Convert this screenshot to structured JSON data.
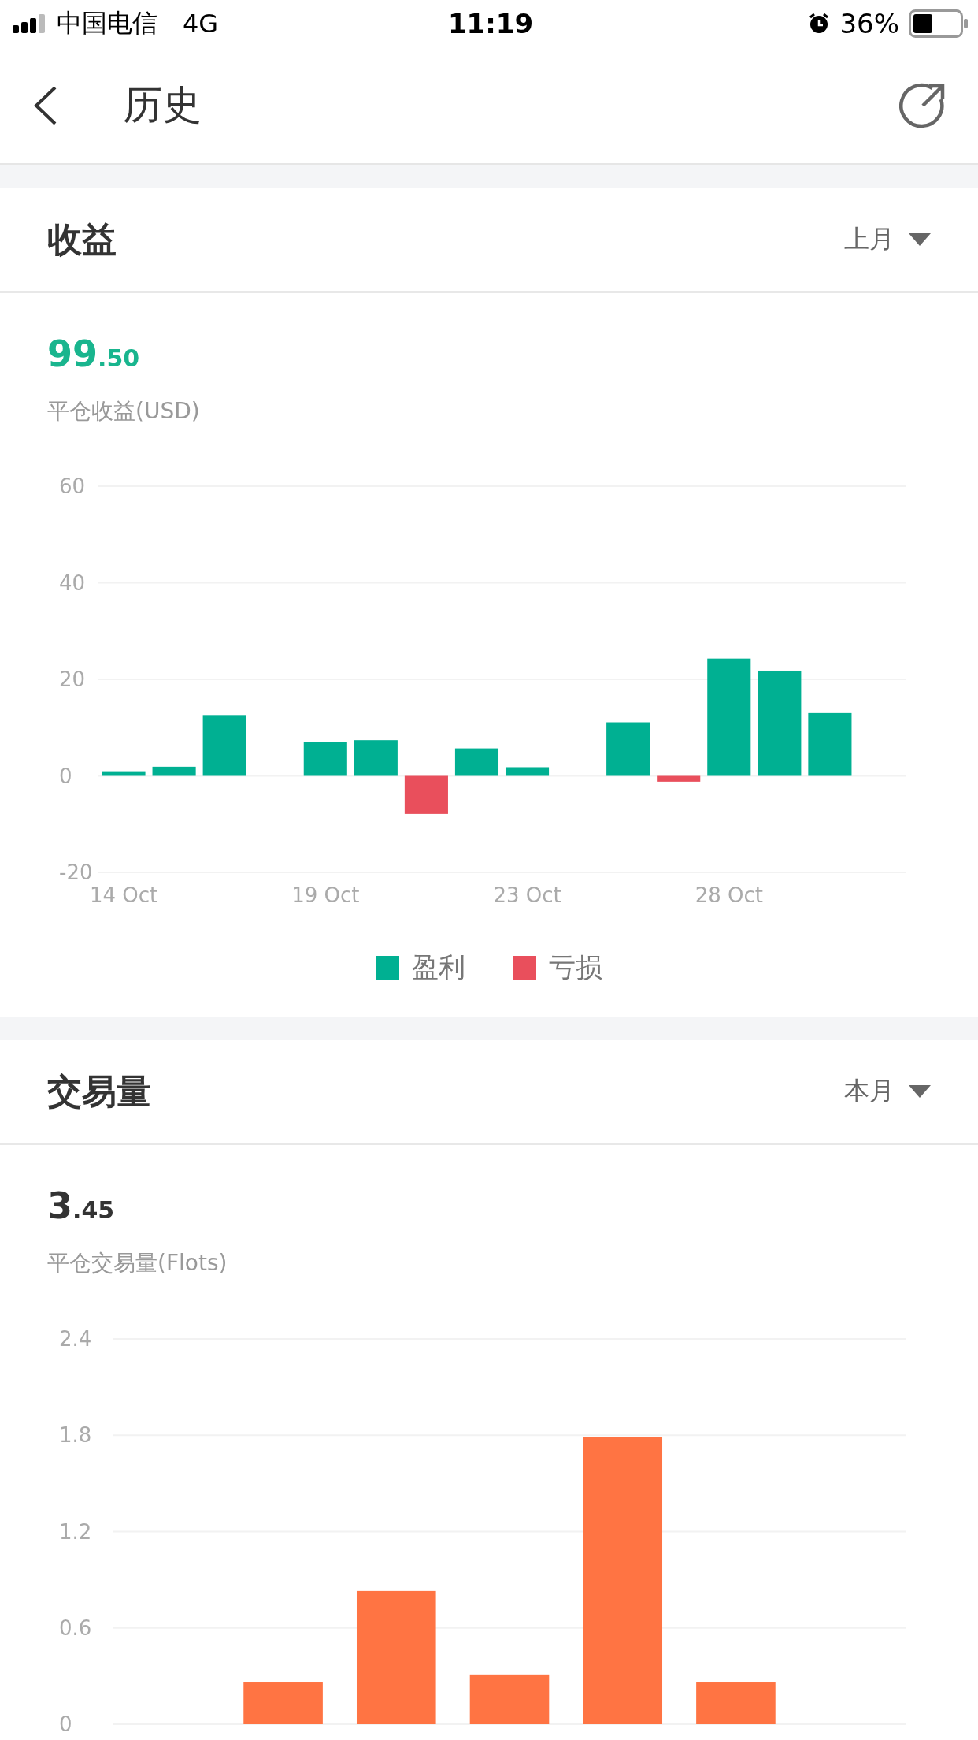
{
  "status_bar": {
    "carrier": "中国电信",
    "network": "4G",
    "time": "11:19",
    "battery": "36%"
  },
  "nav": {
    "title": "历史"
  },
  "sections": [
    {
      "kind": "profit",
      "title": "收益",
      "period": "上月",
      "value": "99.50",
      "value_label": "平仓收益(USD)",
      "chart_data": {
        "type": "bar",
        "categories": [
          "14 Oct",
          null,
          null,
          null,
          "19 Oct",
          null,
          null,
          null,
          "23 Oct",
          null,
          null,
          null,
          "28 Oct",
          null,
          null,
          null
        ],
        "ylim": [
          -20,
          60
        ],
        "yticks": [
          -20,
          0,
          20,
          40,
          60
        ],
        "grid": true,
        "legend": "bottom",
        "stacked": true,
        "series": [
          {
            "name": "盈利",
            "color": "#00b092",
            "values": [
              0.8,
              1.9,
              12.6,
              null,
              7.1,
              7.4,
              null,
              5.7,
              1.8,
              null,
              11.1,
              null,
              24.3,
              21.8,
              13.0,
              null
            ]
          },
          {
            "name": "亏损",
            "color": "#e94f5c",
            "values": [
              null,
              null,
              null,
              null,
              null,
              null,
              -7.9,
              null,
              null,
              null,
              null,
              -1.2,
              null,
              null,
              null,
              null
            ]
          }
        ]
      }
    },
    {
      "kind": "volume",
      "title": "交易量",
      "period": "本月",
      "value": "3.45",
      "value_label": "平仓交易量(Flots)",
      "chart_data": {
        "type": "bar",
        "categories": [
          null,
          null,
          null,
          null,
          null,
          null,
          null
        ],
        "ylim": [
          0,
          2.4
        ],
        "yticks": [
          0,
          0.6,
          1.2,
          1.8,
          2.4
        ],
        "grid": true,
        "series": [
          {
            "color": "#ff7443",
            "values": [
              null,
              0.26,
              0.83,
              0.31,
              1.79,
              0.26,
              null
            ]
          }
        ]
      }
    }
  ]
}
